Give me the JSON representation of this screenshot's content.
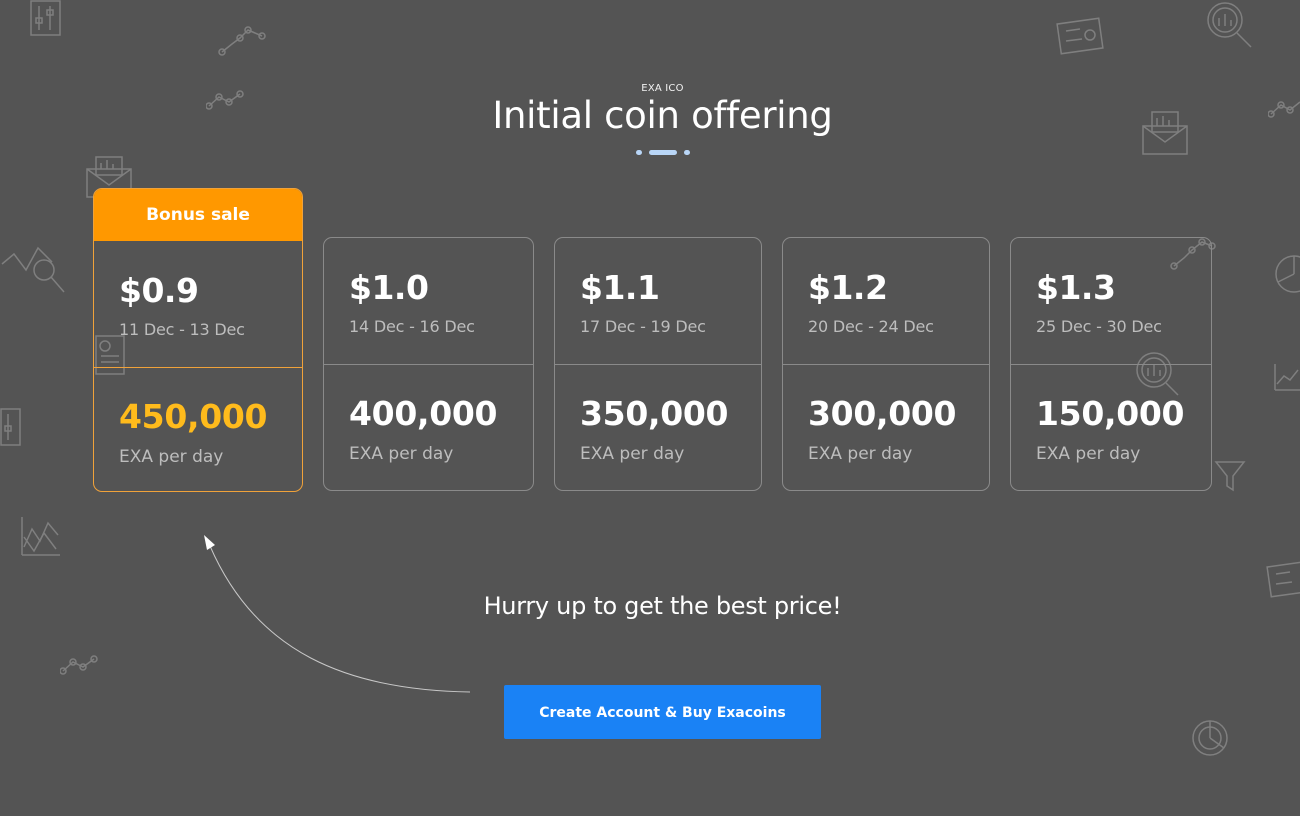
{
  "header": {
    "eyebrow": "EXA ICO",
    "title": "Initial coin offering"
  },
  "featured_badge": "Bonus sale",
  "tiers": [
    {
      "price": "$0.9",
      "dates": "11 Dec - 13 Dec",
      "amount": "450,000",
      "unit": "EXA per day",
      "featured": true
    },
    {
      "price": "$1.0",
      "dates": "14 Dec - 16 Dec",
      "amount": "400,000",
      "unit": "EXA per day",
      "featured": false
    },
    {
      "price": "$1.1",
      "dates": "17 Dec - 19 Dec",
      "amount": "350,000",
      "unit": "EXA per day",
      "featured": false
    },
    {
      "price": "$1.2",
      "dates": "20 Dec - 24 Dec",
      "amount": "300,000",
      "unit": "EXA per day",
      "featured": false
    },
    {
      "price": "$1.3",
      "dates": "25 Dec - 30 Dec",
      "amount": "150,000",
      "unit": "EXA per day",
      "featured": false
    }
  ],
  "cta": {
    "tagline": "Hurry up to get the best price!",
    "button_label": "Create Account & Buy Exacoins"
  },
  "colors": {
    "background": "#545454",
    "accent_orange": "#ff9800",
    "featured_amount": "#ffbb1c",
    "button_blue": "#1a82f5",
    "underline_blue": "#b9d6f7"
  }
}
